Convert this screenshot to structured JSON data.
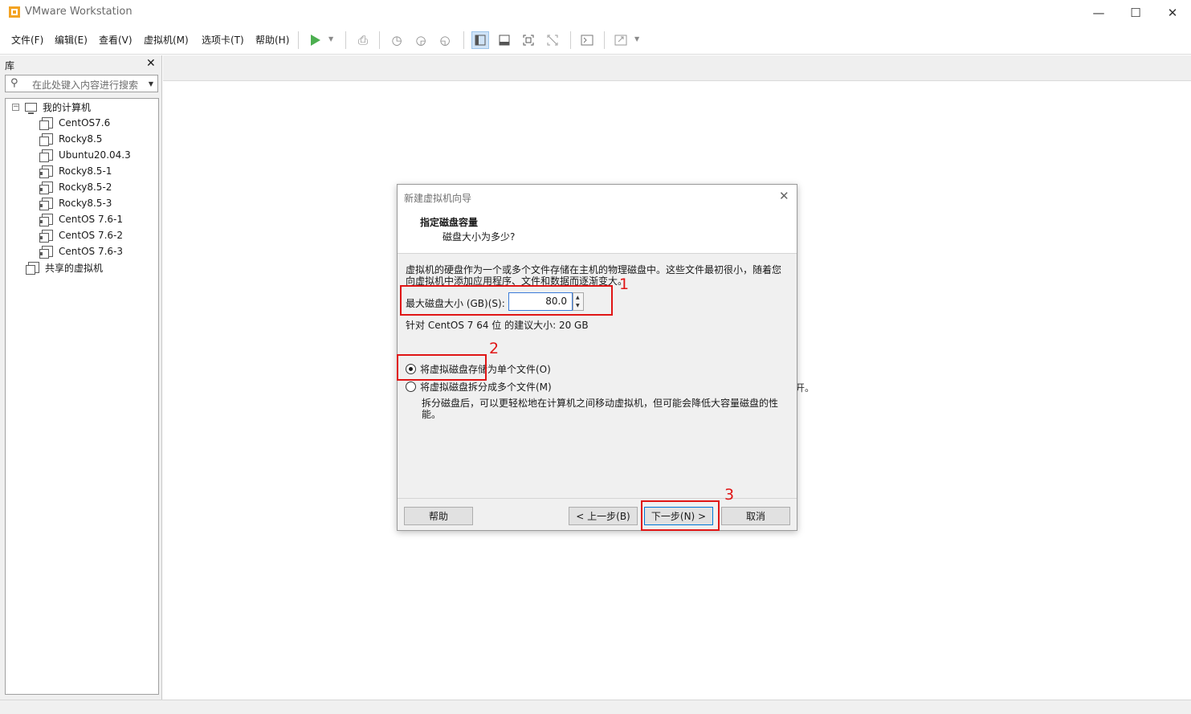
{
  "window": {
    "title": "VMware Workstation",
    "controls": {
      "minimize": "—",
      "maximize": "☐",
      "close": "✕"
    }
  },
  "menu": [
    "文件(F)",
    "编辑(E)",
    "查看(V)",
    "虚拟机(M)",
    "选项卡(T)",
    "帮助(H)"
  ],
  "toolbar": {
    "icons": [
      "play-icon",
      "send-keys-icon",
      "snapshot-icon",
      "revert-snapshot-icon",
      "snapshot-manager-icon",
      "library-view-icon",
      "thumbnail-view-icon",
      "full-screen-icon",
      "unity-icon",
      "console-icon",
      "stretch-icon"
    ]
  },
  "library": {
    "header": "库",
    "close": "✕",
    "search_placeholder": "在此处键入内容进行搜索",
    "root": "我的计算机",
    "vms": [
      {
        "name": "CentOS7.6",
        "state": "off"
      },
      {
        "name": "Rocky8.5",
        "state": "off"
      },
      {
        "name": "Ubuntu20.04.3",
        "state": "off"
      },
      {
        "name": "Rocky8.5-1",
        "state": "cloned"
      },
      {
        "name": "Rocky8.5-2",
        "state": "cloned"
      },
      {
        "name": "Rocky8.5-3",
        "state": "cloned"
      },
      {
        "name": "CentOS 7.6-1",
        "state": "cloned"
      },
      {
        "name": "CentOS 7.6-2",
        "state": "cloned"
      },
      {
        "name": "CentOS 7.6-3",
        "state": "cloned"
      }
    ],
    "shared": "共享的虚拟机"
  },
  "background_fragment": "开。",
  "dialog": {
    "title": "新建虚拟机向导",
    "close": "✕",
    "heading": "指定磁盘容量",
    "subheading": "磁盘大小为多少?",
    "description": "虚拟机的硬盘作为一个或多个文件存储在主机的物理磁盘中。这些文件最初很小，随着您向虚拟机中添加应用程序、文件和数据而逐渐变大。",
    "size_label": "最大磁盘大小 (GB)(S):",
    "size_value": "80.0",
    "recommendation": "针对 CentOS 7 64 位 的建议大小: 20 GB",
    "option_single": "将虚拟磁盘存储为单个文件(O)",
    "option_split": "将虚拟磁盘拆分成多个文件(M)",
    "option_split_desc": "拆分磁盘后，可以更轻松地在计算机之间移动虚拟机，但可能会降低大容量磁盘的性能。",
    "selected_option": "single",
    "buttons": {
      "help": "帮助",
      "back": "< 上一步(B)",
      "next": "下一步(N) >",
      "cancel": "取消"
    }
  },
  "annotations": [
    "1",
    "2",
    "3"
  ],
  "colors": {
    "annotation": "#e01515",
    "play": "#4caf50",
    "accent": "#0078d7"
  }
}
